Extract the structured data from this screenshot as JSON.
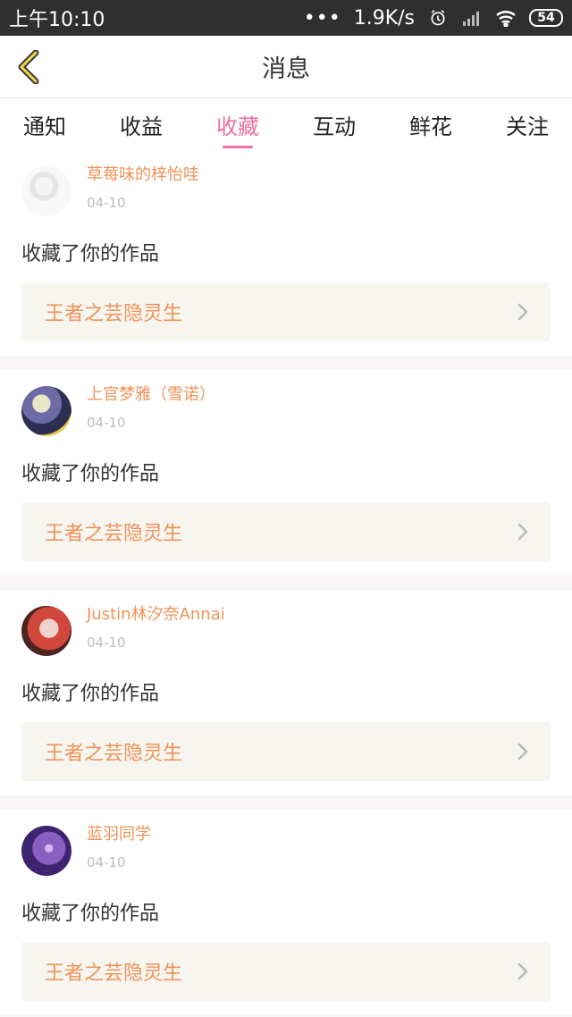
{
  "status": {
    "time": "上午10:10",
    "dots": "•••",
    "speed": "1.9K/s",
    "battery": "54"
  },
  "header": {
    "title": "消息"
  },
  "tabs": [
    {
      "label": "通知"
    },
    {
      "label": "收益"
    },
    {
      "label": "收藏"
    },
    {
      "label": "互动"
    },
    {
      "label": "鲜花"
    },
    {
      "label": "关注"
    }
  ],
  "messages": [
    {
      "user": "草莓味的梓怡哇",
      "date": "04-10",
      "action": "收藏了你的作品",
      "work": "王者之芸隐灵生"
    },
    {
      "user": "上官梦雅（雪诺）",
      "date": "04-10",
      "action": "收藏了你的作品",
      "work": "王者之芸隐灵生"
    },
    {
      "user": "Justin林汐奈Annai",
      "date": "04-10",
      "action": "收藏了你的作品",
      "work": "王者之芸隐灵生"
    },
    {
      "user": "蓝羽同学",
      "date": "04-10",
      "action": "收藏了你的作品",
      "work": "王者之芸隐灵生"
    }
  ],
  "icons": {
    "back": "chevron-left-icon",
    "chevron": "chevron-right-icon",
    "alarm": "alarm-icon",
    "signal": "signal-icon",
    "wifi": "wifi-icon"
  },
  "colors": {
    "accent": "#ef6fa3",
    "username": "#ef9258",
    "status_bg": "#2f2f2f"
  }
}
